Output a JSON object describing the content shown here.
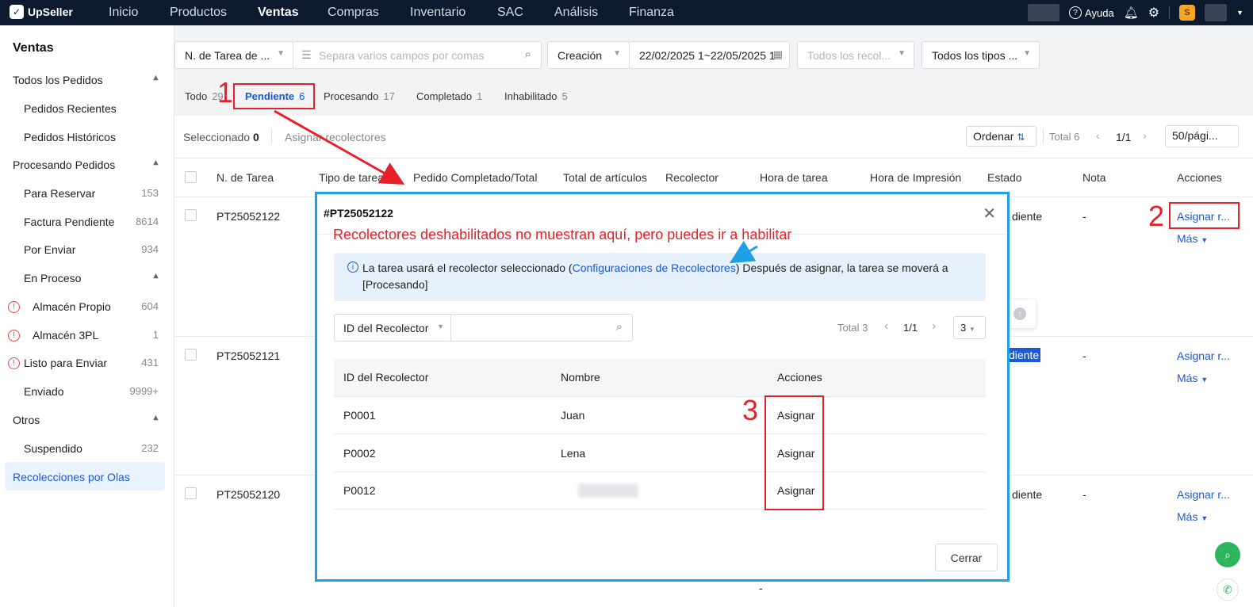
{
  "app": {
    "name": "UpSeller"
  },
  "nav": {
    "items": [
      "Inicio",
      "Productos",
      "Ventas",
      "Compras",
      "Inventario",
      "SAC",
      "Análisis",
      "Finanza"
    ],
    "help": "Ayuda"
  },
  "sidebar": {
    "title": "Ventas",
    "items": [
      {
        "label": "Todos los Pedidos",
        "count": ""
      },
      {
        "label": "Pedidos Recientes",
        "count": ""
      },
      {
        "label": "Pedidos Históricos",
        "count": ""
      },
      {
        "label": "Procesando Pedidos",
        "count": ""
      },
      {
        "label": "Para Reservar",
        "count": "153"
      },
      {
        "label": "Factura Pendiente",
        "count": "8614"
      },
      {
        "label": "Por Enviar",
        "count": "934"
      },
      {
        "label": "En Proceso",
        "count": ""
      },
      {
        "label": "Almacén Propio",
        "count": "604"
      },
      {
        "label": "Almacén 3PL",
        "count": "1"
      },
      {
        "label": "Listo para Enviar",
        "count": "431"
      },
      {
        "label": "Enviado",
        "count": "9999+"
      },
      {
        "label": "Otros",
        "count": ""
      },
      {
        "label": "Suspendido",
        "count": "232"
      },
      {
        "label": "Recolecciones por Olas",
        "count": ""
      }
    ]
  },
  "filters": {
    "field_select": "N. de Tarea de ...",
    "search_placeholder": "Separa varios campos por comas",
    "date_type": "Creación",
    "date_range": "22/02/2025 1~22/05/2025 1",
    "picker_placeholder": "Todos los recol...",
    "type_select": "Todos los tipos ..."
  },
  "tabs": [
    {
      "label": "Todo",
      "count": "29"
    },
    {
      "label": "Pendiente",
      "count": "6"
    },
    {
      "label": "Procesando",
      "count": "17"
    },
    {
      "label": "Completado",
      "count": "1"
    },
    {
      "label": "Inhabilitado",
      "count": "5"
    }
  ],
  "toolbar": {
    "selected_label": "Seleccionado",
    "selected_count": "0",
    "assign_label": "Asignar recolectores",
    "sort_label": "Ordenar",
    "total": "Total 6",
    "page": "1/1",
    "page_size": "50/pági..."
  },
  "table": {
    "headers": [
      "N. de Tarea",
      "Tipo de tarea",
      "Pedido Completado/Total",
      "Total de artículos",
      "Recolector",
      "Hora de tarea",
      "Hora de Impresión",
      "Estado",
      "Nota",
      "Acciones"
    ],
    "rows": [
      {
        "id": "PT25052122",
        "estado": "diente",
        "nota": "-",
        "action": "Asignar r...",
        "more": "Más"
      },
      {
        "id": "PT25052121",
        "estado": "diente",
        "nota": "-",
        "action": "Asignar r...",
        "more": "Más"
      },
      {
        "id": "PT25052120",
        "estado": "diente",
        "nota": "-",
        "action": "Asignar r...",
        "more": "Más"
      }
    ],
    "footer_dash": "-"
  },
  "modal": {
    "title": "#PT25052122",
    "info_prefix": "La tarea usará el recolector seleccionado (",
    "info_link": "Configuraciones de Recolectores",
    "info_suffix": ") Después de asignar, la tarea se moverá a",
    "info_line2": "[Procesando]",
    "search_field": "ID del Recolector",
    "total": "Total 3",
    "page": "1/1",
    "page_size": "3",
    "headers": [
      "ID del Recolector",
      "Nombre",
      "Acciones"
    ],
    "rows": [
      {
        "id": "P0001",
        "name": "Juan",
        "action": "Asignar"
      },
      {
        "id": "P0002",
        "name": "Lena",
        "action": "Asignar"
      },
      {
        "id": "P0012",
        "name": "",
        "action": "Asignar"
      }
    ],
    "close_button": "Cerrar"
  },
  "annotations": {
    "note": "Recolectores deshabilitados no muestran aquí, pero puedes ir a habilitar",
    "step1": "1",
    "step2": "2",
    "step3": "3",
    "color": "#e8202a"
  }
}
